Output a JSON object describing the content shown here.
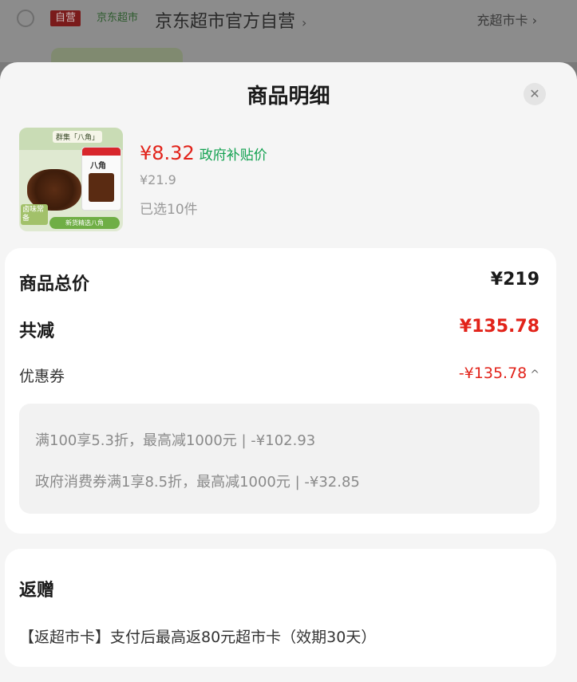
{
  "background": {
    "self_operated_badge": "自营",
    "jd_supermarket_badge": "京东超市",
    "store_name": "京东超市官方自营",
    "recharge_label": "充超市卡"
  },
  "sheet": {
    "title": "商品明细",
    "close_icon": "close-icon"
  },
  "product": {
    "price": "¥8.32",
    "subsidy_label": "政府补贴价",
    "original_price": "¥21.9",
    "quantity_text": "已选10件",
    "image": {
      "brand": "群集「八角」",
      "pack_label": "八角",
      "tag": "卤味常备",
      "banner": "新货精选八角"
    }
  },
  "price_details": {
    "total_label": "商品总价",
    "total_value": "¥219",
    "discount_label": "共减",
    "discount_value": "¥135.78",
    "coupon_label": "优惠券",
    "coupon_value": "-¥135.78",
    "coupon_lines": [
      "满100享5.3折，最高减1000元 | -¥102.93",
      "政府消费券满1享8.5折，最高减1000元 | -¥32.85"
    ]
  },
  "gift": {
    "title": "返赠",
    "description": "【返超市卡】支付后最高返80元超市卡（效期30天）"
  },
  "colors": {
    "price_red": "#e2231a",
    "subsidy_green": "#12a150",
    "sheet_bg": "#f5f5f5"
  }
}
